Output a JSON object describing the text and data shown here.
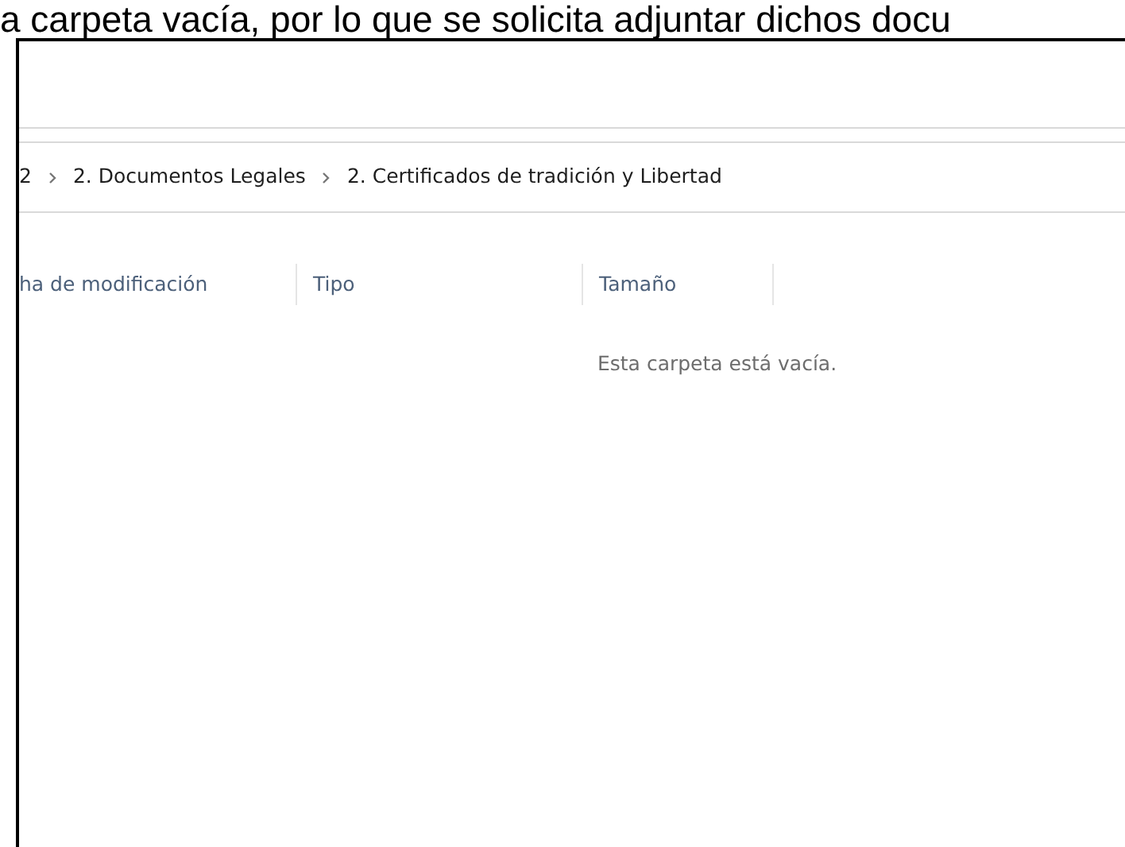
{
  "caption_text": "a carpeta vacía, por lo que se solicita adjuntar dichos docu",
  "breadcrumb": [
    {
      "label": "2"
    },
    {
      "label": "2. Documentos Legales"
    },
    {
      "label": "2. Certificados de tradición y Libertad"
    }
  ],
  "columns": [
    "ha de modificación",
    "Tipo",
    "Tamaño"
  ],
  "empty_message": "Esta carpeta está vacía."
}
